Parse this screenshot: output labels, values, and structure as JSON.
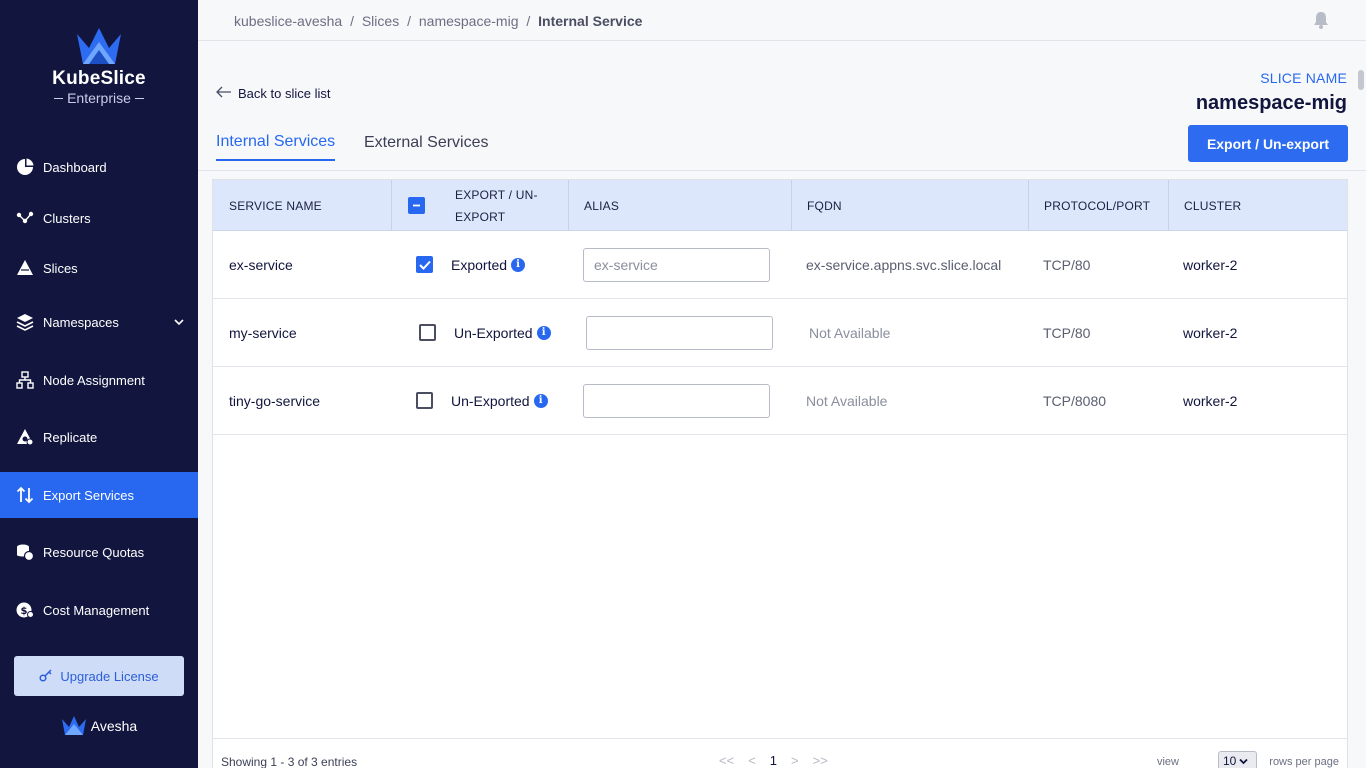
{
  "brand": {
    "name": "KubeSlice",
    "edition": "Enterprise",
    "footer_name": "Avesha",
    "accent": "#2868f0",
    "sidebar_bg": "#12153e"
  },
  "sidebar": {
    "items": [
      {
        "label": "Dashboard",
        "icon": "pie-chart-icon",
        "active": false
      },
      {
        "label": "Clusters",
        "icon": "clusters-icon",
        "active": false
      },
      {
        "label": "Slices",
        "icon": "slices-icon",
        "active": false
      },
      {
        "label": "Namespaces",
        "icon": "layers-icon",
        "active": false,
        "expandable": true
      },
      {
        "label": "Node Assignment",
        "icon": "node-tree-icon",
        "active": false
      },
      {
        "label": "Replicate",
        "icon": "replicate-icon",
        "active": false
      },
      {
        "label": "Export Services",
        "icon": "arrows-up-down-icon",
        "active": true
      },
      {
        "label": "Resource Quotas",
        "icon": "coins-icon",
        "active": false
      },
      {
        "label": "Cost Management",
        "icon": "cost-icon",
        "active": false
      }
    ],
    "upgrade_label": "Upgrade License"
  },
  "header": {
    "breadcrumb": [
      "kubeslice-avesha",
      "Slices",
      "namespace-mig"
    ],
    "breadcrumb_current": "Internal Service",
    "separator": "/"
  },
  "page": {
    "back_label": "Back to slice list",
    "slice_label": "SLICE NAME",
    "slice_name": "namespace-mig",
    "tabs": [
      {
        "label": "Internal Services",
        "active": true
      },
      {
        "label": "External Services",
        "active": false
      }
    ],
    "export_button": "Export / Un-export"
  },
  "table": {
    "columns": {
      "service_name": "SERVICE NAME",
      "export": "EXPORT / UN-EXPORT",
      "alias": "ALIAS",
      "fqdn": "FQDN",
      "protocol": "PROTOCOL/PORT",
      "cluster": "CLUSTER"
    },
    "rows": [
      {
        "service": "ex-service",
        "checked": true,
        "status": "Exported",
        "alias_placeholder": "ex-service",
        "fqdn": "ex-service.appns.svc.slice.local",
        "protocol": "TCP/80",
        "cluster": "worker-2"
      },
      {
        "service": "my-service",
        "checked": false,
        "status": "Un-Exported",
        "alias_placeholder": "",
        "fqdn": "Not Available",
        "protocol": "TCP/80",
        "cluster": "worker-2"
      },
      {
        "service": "tiny-go-service",
        "checked": false,
        "status": "Un-Exported",
        "alias_placeholder": "",
        "fqdn": "Not Available",
        "protocol": "TCP/8080",
        "cluster": "worker-2"
      }
    ],
    "footer": {
      "showing": "Showing 1 - 3 of 3 entries",
      "first": "<<",
      "prev": "<",
      "page": "1",
      "next": ">",
      "last": ">>",
      "view_label": "view",
      "rows_per_page_value": "10",
      "rows_per_page_label": "rows per page"
    }
  }
}
